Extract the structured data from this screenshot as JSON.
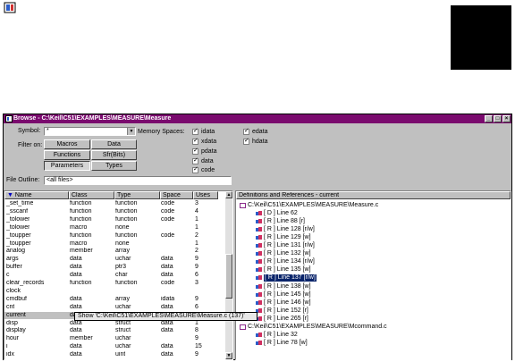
{
  "window": {
    "title": "Browse - C:\\Keil\\C51\\EXAMPLES\\MEASURE\\Measure",
    "minimize": "_",
    "maximize": "□",
    "close": "×"
  },
  "form": {
    "symbol_label": "Symbol:",
    "symbol_value": "*",
    "filter_label": "Filter on:",
    "file_outline_label": "File Outline:",
    "file_outline_value": "<all files>",
    "filter_buttons": [
      "Macros",
      "Data",
      "Functions",
      "Sfr(Bits)",
      "Parameters",
      "Types"
    ],
    "memory_label": "Memory Spaces:",
    "memory_spaces": [
      "idata",
      "xdata",
      "pdata",
      "data",
      "code",
      "edata",
      "hdata"
    ]
  },
  "columns": [
    "Name",
    "Class",
    "Type",
    "Space",
    "Uses"
  ],
  "rows": [
    [
      "_set_time",
      "function",
      "function",
      "code",
      "3"
    ],
    [
      "_sscanf",
      "function",
      "function",
      "code",
      "4"
    ],
    [
      "_tolower",
      "function",
      "function",
      "code",
      "1"
    ],
    [
      "_tolower",
      "macro",
      "none",
      "",
      "1"
    ],
    [
      "_toupper",
      "function",
      "function",
      "code",
      "2"
    ],
    [
      "_toupper",
      "macro",
      "none",
      "",
      "1"
    ],
    [
      "analog",
      "member",
      "array",
      "",
      "2"
    ],
    [
      "args",
      "data",
      "uchar",
      "data",
      "9"
    ],
    [
      "buffer",
      "data",
      "ptr3",
      "data",
      "9"
    ],
    [
      "c",
      "data",
      "char",
      "data",
      "6"
    ],
    [
      "clear_records",
      "function",
      "function",
      "code",
      "3"
    ],
    [
      "clock",
      "",
      "",
      "",
      ""
    ],
    [
      "cmdbuf",
      "data",
      "array",
      "idata",
      "9"
    ],
    [
      "cnt",
      "data",
      "uchar",
      "data",
      "6"
    ],
    [
      "current",
      "data",
      "struct",
      "data",
      "16"
    ],
    [
      "disp",
      "data",
      "struct",
      "data",
      "1"
    ],
    [
      "display",
      "data",
      "struct",
      "data",
      "8"
    ],
    [
      "hour",
      "member",
      "uchar",
      "",
      "9"
    ],
    [
      "i",
      "data",
      "uchar",
      "data",
      "15"
    ],
    [
      "idx",
      "data",
      "uint",
      "data",
      "9"
    ]
  ],
  "tooltip": "Show 'C:\\Keil\\C51\\EXAMPLES\\MEASURE\\Measure.c (137)'",
  "defs": {
    "header": "Definitions and References - current",
    "file1": "C:\\Keil\\C51\\EXAMPLES\\MEASURE\\Measure.c",
    "refs1": [
      "[ D ] Line 62",
      "[ R ] Line 88 [r]",
      "[ R ] Line 128 [r/w]",
      "[ R ] Line 129 [w]",
      "[ R ] Line 131 [r/w]",
      "[ R ] Line 132 [w]",
      "[ R ] Line 134 [r/w]",
      "[ R ] Line 135 [w]",
      "[ R ] Line 137 [r/w]",
      "[ R ] Line 138 [w]",
      "[ R ] Line 145 [w]",
      "[ R ] Line 146 [w]",
      "[ R ] Line 152 [r]",
      "[ R ] Line 265 [r]"
    ],
    "file2": "C:\\Keil\\C51\\EXAMPLES\\MEASURE\\Mcommand.c",
    "refs2": [
      "[ R ] Line 32",
      "[ R ] Line 78 [w]"
    ]
  },
  "colors": {
    "titlebar": "#7a0a6e",
    "selection": "#0a246a",
    "window_bg": "#c0c0c0"
  }
}
